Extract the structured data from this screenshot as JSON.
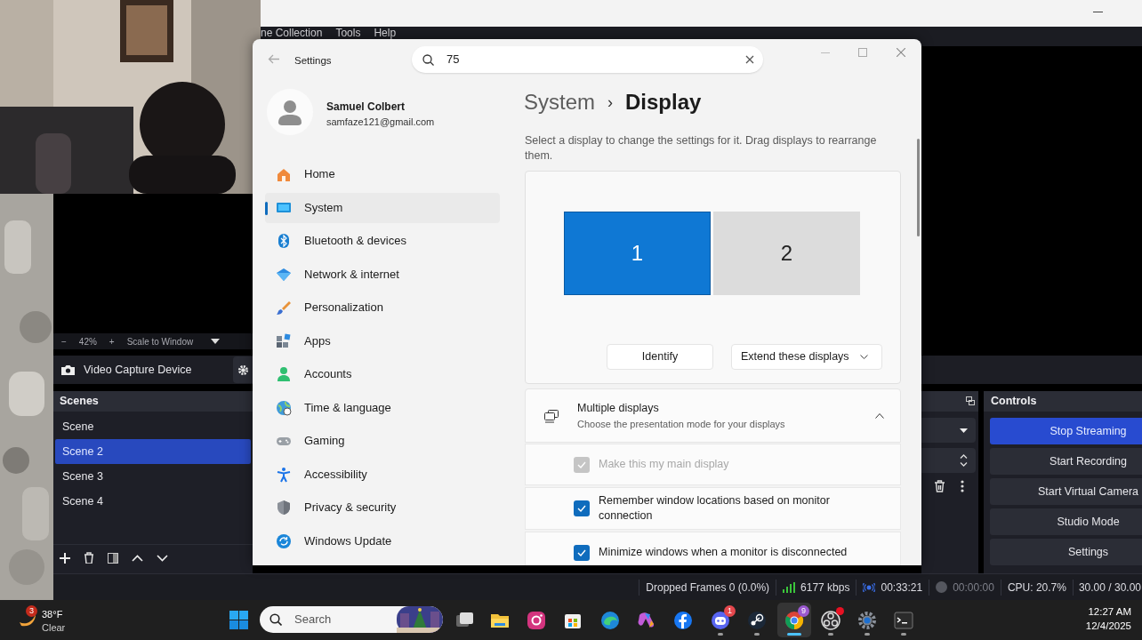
{
  "obs": {
    "menu": [
      "ne Collection",
      "Tools",
      "Help"
    ],
    "zoom": {
      "minus": "−",
      "level": "42%",
      "plus": "+",
      "mode": "Scale to Window"
    },
    "source": "Video Capture Device",
    "scenes": {
      "title": "Scenes",
      "items": [
        {
          "label": "Scene",
          "selected": false
        },
        {
          "label": "Scene 2",
          "selected": true
        },
        {
          "label": "Scene 3",
          "selected": false
        },
        {
          "label": "Scene 4",
          "selected": false
        }
      ]
    },
    "controls": {
      "title": "Controls",
      "buttons": [
        {
          "label": "Stop Streaming",
          "active": true
        },
        {
          "label": "Start Recording",
          "active": false
        },
        {
          "label": "Start Virtual Camera",
          "active": false
        },
        {
          "label": "Studio Mode",
          "active": false
        },
        {
          "label": "Settings",
          "active": false
        }
      ]
    },
    "status_bar": {
      "dropped_frames": "Dropped Frames 0 (0.0%)",
      "bitrate": "6177 kbps",
      "stream_time": "00:33:21",
      "record_time": "00:00:00",
      "cpu": "CPU: 20.7%",
      "fps": "30.00 / 30.00"
    }
  },
  "settings": {
    "title": "Settings",
    "search": {
      "value": "75"
    },
    "user": {
      "name": "Samuel Colbert",
      "email": "samfaze121@gmail.com"
    },
    "nav": [
      {
        "label": "Home",
        "selected": false
      },
      {
        "label": "System",
        "selected": true
      },
      {
        "label": "Bluetooth & devices",
        "selected": false
      },
      {
        "label": "Network & internet",
        "selected": false
      },
      {
        "label": "Personalization",
        "selected": false
      },
      {
        "label": "Apps",
        "selected": false
      },
      {
        "label": "Accounts",
        "selected": false
      },
      {
        "label": "Time & language",
        "selected": false
      },
      {
        "label": "Gaming",
        "selected": false
      },
      {
        "label": "Accessibility",
        "selected": false
      },
      {
        "label": "Privacy & security",
        "selected": false
      },
      {
        "label": "Windows Update",
        "selected": false
      }
    ],
    "breadcrumb": {
      "parent": "System",
      "separator": "›",
      "current": "Display"
    },
    "description": "Select a display to change the settings for it. Drag displays to rearrange them.",
    "displays": [
      {
        "label": "1",
        "selected": true
      },
      {
        "label": "2",
        "selected": false
      }
    ],
    "identify": "Identify",
    "mode": "Extend these displays",
    "multiple_displays": {
      "title": "Multiple displays",
      "subtitle": "Choose the presentation mode for your displays",
      "expanded": true,
      "options": [
        {
          "label": "Make this my main display",
          "checked": true,
          "disabled": true
        },
        {
          "label": "Remember window locations based on monitor connection",
          "checked": true,
          "disabled": false
        },
        {
          "label": "Minimize windows when a monitor is disconnected",
          "checked": true,
          "disabled": false
        }
      ]
    }
  },
  "taskbar": {
    "weather": {
      "badge": "3",
      "temperature": "38°F",
      "condition": "Clear"
    },
    "search": {
      "placeholder": "Search"
    },
    "apps": [
      {
        "running": false,
        "active": false,
        "alert": false
      },
      {
        "running": false,
        "active": false,
        "alert": false
      },
      {
        "running": false,
        "active": false,
        "alert": false
      },
      {
        "running": false,
        "active": false,
        "alert": false
      },
      {
        "running": false,
        "active": false,
        "alert": false
      },
      {
        "running": false,
        "active": false,
        "alert": false
      },
      {
        "running": false,
        "active": false,
        "alert": false
      },
      {
        "running": true,
        "active": false,
        "alert": false,
        "badge": "1"
      },
      {
        "running": true,
        "active": false,
        "alert": false
      },
      {
        "running": true,
        "active": true,
        "alert": false,
        "badge": "9"
      },
      {
        "running": true,
        "active": false,
        "alert": true
      },
      {
        "running": true,
        "active": false,
        "alert": false
      },
      {
        "running": true,
        "active": false,
        "alert": false
      }
    ],
    "clock": {
      "time": "12:27 AM",
      "date": "12/4/2025"
    }
  }
}
